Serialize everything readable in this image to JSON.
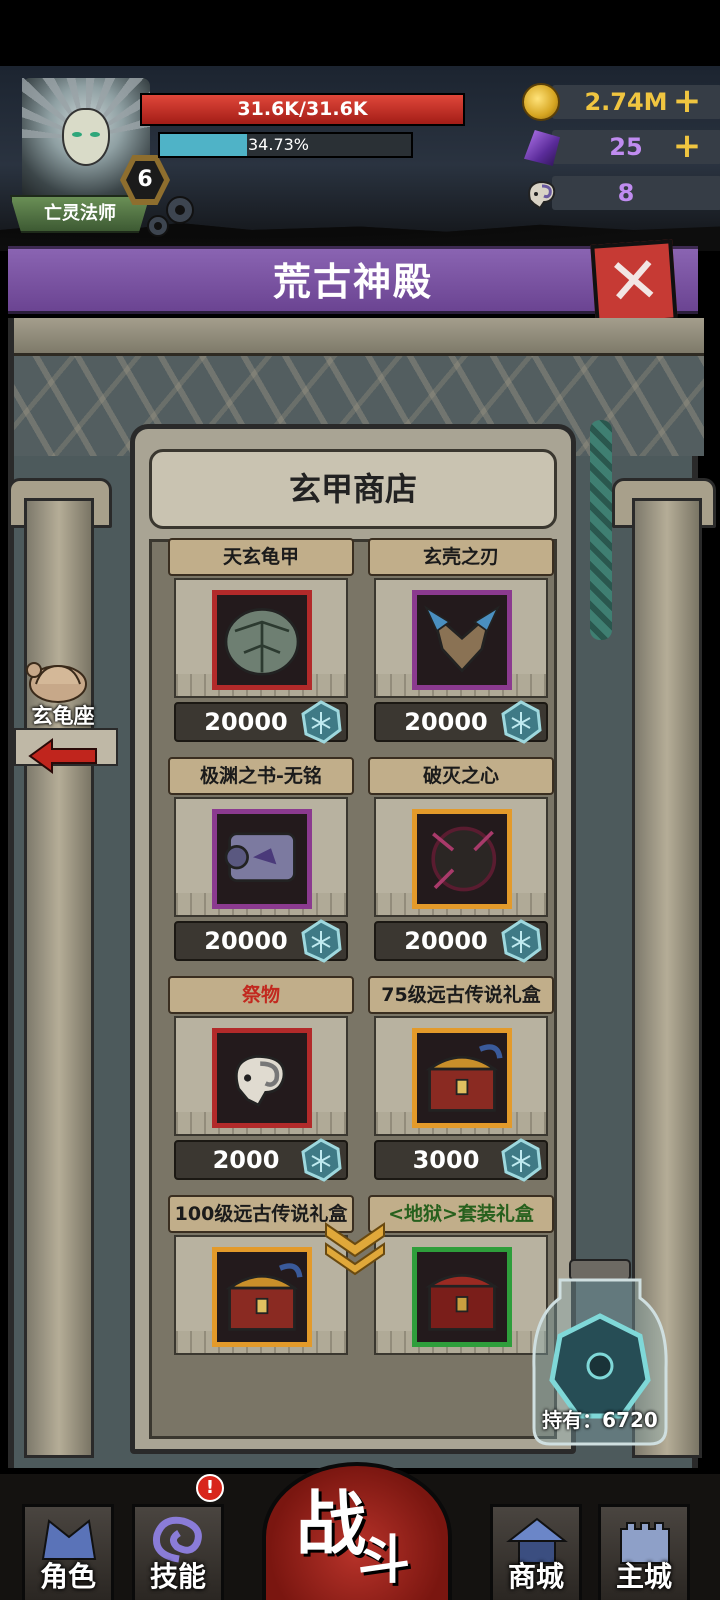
{
  "player": {
    "class_name": "亡灵法师",
    "level": "6",
    "hp_text": "31.6K/31.6K",
    "hp_fraction": 1.0,
    "xp_text": "34.73%",
    "xp_fraction": 0.3473
  },
  "resources": [
    {
      "name": "gold",
      "icon": "gold-coin-icon",
      "value": "2.74M",
      "has_plus": true,
      "color": "#f0c540"
    },
    {
      "name": "gem",
      "icon": "purple-gem-icon",
      "value": "25",
      "has_plus": true,
      "color": "#c08cf0"
    },
    {
      "name": "ram-skull",
      "icon": "ram-skull-icon",
      "value": "8",
      "has_plus": false,
      "color": "#c08cf0"
    }
  ],
  "title": "荒古神殿",
  "shop": {
    "title": "玄甲商店",
    "pedestal_label": "玄龟座",
    "currency_icon": "xuan-shard-icon",
    "items": [
      {
        "name": "天玄龟甲",
        "price": "20000",
        "frame": "red",
        "name_color": "dark",
        "icon": "turtle-shell-icon"
      },
      {
        "name": "玄壳之刃",
        "price": "20000",
        "frame": "purple",
        "name_color": "dark",
        "icon": "shell-blade-icon"
      },
      {
        "name": "极渊之书-无铭",
        "price": "20000",
        "frame": "purple",
        "name_color": "dark",
        "icon": "abyss-scroll-icon"
      },
      {
        "name": "破灭之心",
        "price": "20000",
        "frame": "gold",
        "name_color": "dark",
        "icon": "dark-heart-icon"
      },
      {
        "name": "祭物",
        "price": "2000",
        "frame": "red",
        "name_color": "red",
        "icon": "ram-skull-icon"
      },
      {
        "name": "75级远古传说礼盒",
        "price": "3000",
        "frame": "gold",
        "name_color": "dark",
        "icon": "dragon-chest-icon"
      },
      {
        "name": "100级远古传说礼盒",
        "price": "",
        "frame": "gold",
        "name_color": "dark",
        "icon": "dragon-chest-icon"
      },
      {
        "name": "<地狱>套装礼盒",
        "price": "",
        "frame": "green",
        "name_color": "green",
        "icon": "hell-chest-icon"
      }
    ],
    "holding_label": "持有：6720"
  },
  "nav": {
    "role": "角色",
    "skill": "技能",
    "skill_badge": "!",
    "battle_1": "战",
    "battle_2": "斗",
    "store": "商城",
    "city": "主城"
  }
}
